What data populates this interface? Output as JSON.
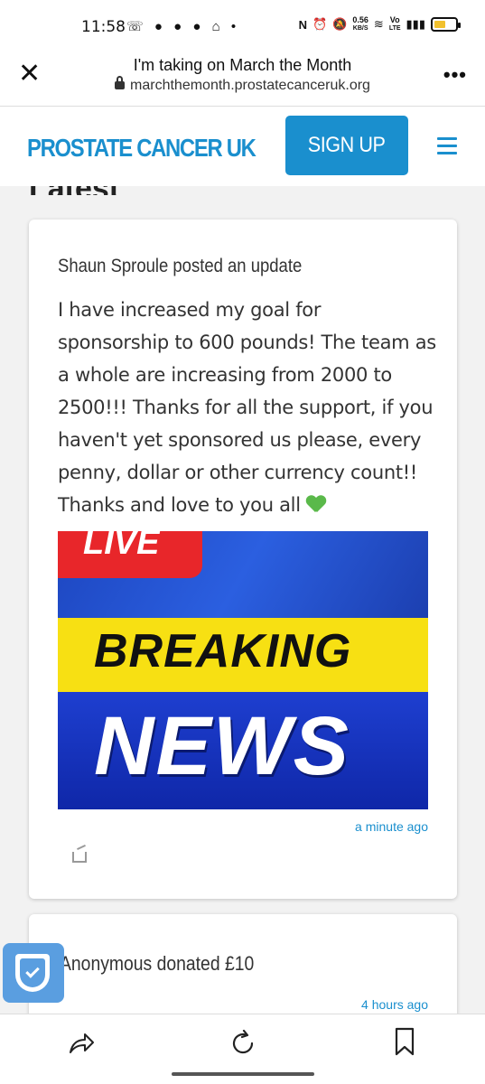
{
  "status_bar": {
    "time": "11:58",
    "net_speed_value": "0.56",
    "net_speed_unit": "KB/S",
    "network_label_top": "Vo",
    "network_label_bottom": "LTE"
  },
  "browser": {
    "page_title": "I'm taking on March the Month",
    "url": "marchthemonth.prostatecanceruk.org"
  },
  "header": {
    "brand": "PROSTATE CANCER UK",
    "signup_label": "SIGN UP"
  },
  "section": {
    "heading": "Latest"
  },
  "feed": [
    {
      "author_line": "Shaun Sproule posted an update",
      "body": "I have increased my goal for sponsorship to 600 pounds!  The team as a whole are increasing from 2000 to 2500!!!  Thanks for all the support, if you haven't yet sponsored us please, every penny, dollar or other currency count!!  Thanks and love to you all",
      "image": {
        "live": "LIVE",
        "breaking": "BREAKING",
        "news": "NEWS"
      },
      "time": "a minute ago"
    },
    {
      "author_line": "Anonymous donated £10",
      "time": "4 hours ago"
    }
  ],
  "colors": {
    "brand_blue": "#1a8fce",
    "heart_green": "#5ab94a",
    "live_red": "#e8262a",
    "breaking_yellow": "#f7e013",
    "fab_blue": "#5a9ee0"
  },
  "icons": [
    "close-icon",
    "lock-icon",
    "more-icon",
    "hamburger-icon",
    "heart-icon",
    "share-icon",
    "shield-icon",
    "forward-icon",
    "refresh-icon",
    "bookmark-icon"
  ]
}
